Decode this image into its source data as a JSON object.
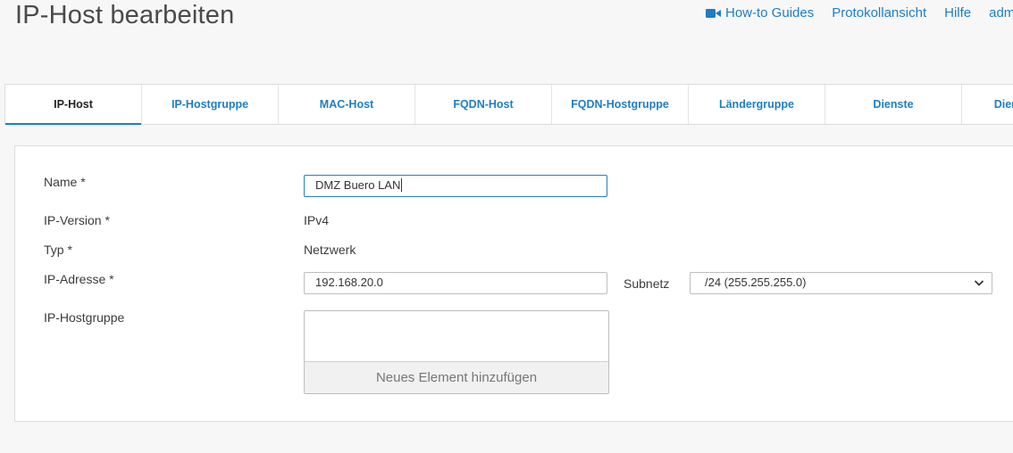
{
  "page": {
    "title": "IP-Host bearbeiten"
  },
  "header_links": {
    "howto": "How-to Guides",
    "protokoll": "Protokollansicht",
    "hilfe": "Hilfe",
    "admin": "admin"
  },
  "tabs": [
    {
      "label": "IP-Host",
      "active": true
    },
    {
      "label": "IP-Hostgruppe",
      "active": false
    },
    {
      "label": "MAC-Host",
      "active": false
    },
    {
      "label": "FQDN-Host",
      "active": false
    },
    {
      "label": "FQDN-Hostgruppe",
      "active": false
    },
    {
      "label": "Ländergruppe",
      "active": false
    },
    {
      "label": "Dienste",
      "active": false
    },
    {
      "label": "Dienstgruppe",
      "active": false
    }
  ],
  "form": {
    "name_label": "Name *",
    "name_value": "DMZ Buero LAN",
    "ipversion_label": "IP-Version *",
    "ipversion_value": "IPv4",
    "typ_label": "Typ *",
    "typ_value": "Netzwerk",
    "ipaddr_label": "IP-Adresse *",
    "ipaddr_value": "192.168.20.0",
    "subnet_label": "Subnetz",
    "subnet_value": "/24 (255.255.255.0)",
    "hostgroup_label": "IP-Hostgruppe",
    "add_element": "Neues Element hinzufügen"
  },
  "colors": {
    "accent": "#1f7ec2",
    "background": "#f7f7f7"
  },
  "icons": {
    "video": "video-camera-icon",
    "dropdown": "chevron-down-icon"
  }
}
